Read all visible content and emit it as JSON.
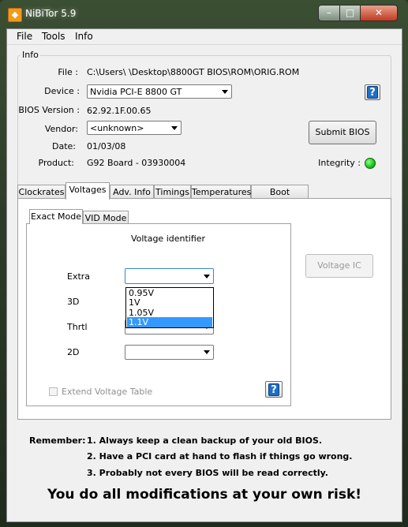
{
  "window": {
    "title": "NiBiTor 5.9",
    "app_icon_glyph": "◆",
    "controls": {
      "minimize": "–",
      "maximize": "□",
      "close": "✕"
    }
  },
  "menu": [
    "File",
    "Tools",
    "Info"
  ],
  "info": {
    "group_label": "Info",
    "file_label": "File :",
    "file_value": "C:\\Users\\                    \\Desktop\\8800GT BIOS\\ROM\\ORIG.ROM",
    "device_label": "Device :",
    "device_value": "Nvidia PCI-E 8800 GT",
    "bios_label": "BIOS Version :",
    "bios_value": "62.92.1F.00.65",
    "vendor_label": "Vendor:",
    "vendor_value": "<unknown>",
    "date_label": "Date:",
    "date_value": "01/03/08",
    "product_label": "Product:",
    "product_value": "G92 Board - 03930004",
    "submit_label": "Submit BIOS",
    "integrity_label": "Integrity :",
    "integrity_color": "#19c319",
    "help_glyph": "?"
  },
  "tabs": [
    "Clockrates",
    "Voltages",
    "Adv. Info",
    "Timings",
    "Temperatures",
    "Boot Settings"
  ],
  "active_tab": "Voltages",
  "voltages": {
    "subtabs": [
      "Exact Mode",
      "VID Mode"
    ],
    "heading": "Voltage identifier",
    "rows": [
      "Extra",
      "3D",
      "Thrtl",
      "2D"
    ],
    "dropdown_options": [
      "0.95V",
      "1V",
      "1.05V",
      "1.1V"
    ],
    "selected_option": "1.1V",
    "extend_label": "Extend Voltage Table",
    "voltage_ic_label": "Voltage IC",
    "help_glyph": "?"
  },
  "remember": {
    "label": "Remember:",
    "lines": [
      "1. Always keep a clean backup of your old BIOS.",
      "2. Have a PCI card at hand to flash if things go wrong.",
      "3. Probably not every BIOS will be read correctly."
    ]
  },
  "warning": "You do all modifications at your own risk!"
}
